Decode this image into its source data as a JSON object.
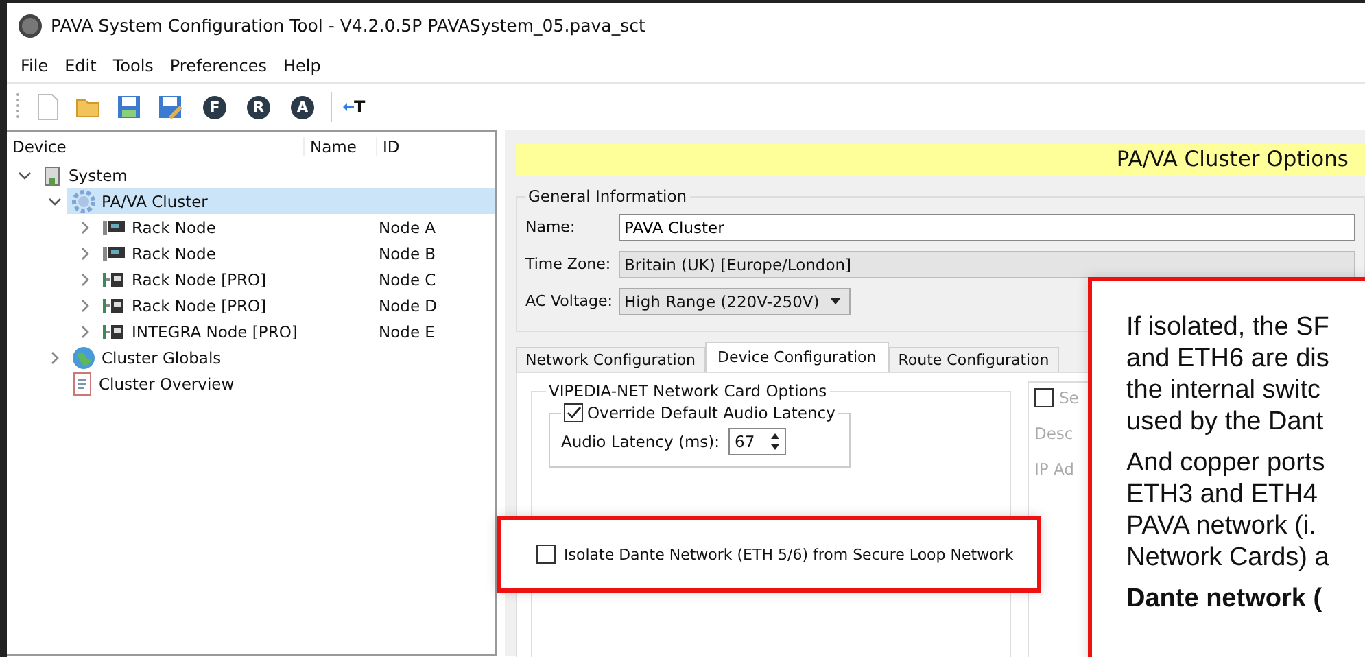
{
  "window": {
    "title": "PAVA System Configuration Tool - V4.2.0.5P PAVASystem_05.pava_sct"
  },
  "menu": [
    "File",
    "Edit",
    "Tools",
    "Preferences",
    "Help"
  ],
  "toolbar": [
    {
      "kind": "new"
    },
    {
      "kind": "open"
    },
    {
      "kind": "save"
    },
    {
      "kind": "saveas"
    },
    {
      "kind": "letter",
      "label": "F"
    },
    {
      "kind": "letter",
      "label": "R"
    },
    {
      "kind": "letter",
      "label": "A"
    },
    {
      "kind": "sep"
    },
    {
      "kind": "text",
      "label": "T"
    }
  ],
  "tree": {
    "columns": [
      "Device",
      "Name",
      "ID"
    ],
    "items": [
      {
        "label": "System",
        "kind": "building",
        "expanded": true,
        "selected": false,
        "children": [
          {
            "label": "PA/VA Cluster",
            "kind": "gear",
            "expanded": true,
            "selected": true,
            "children": [
              {
                "label": "Rack Node",
                "name": "Node A",
                "kind": "rack",
                "expanded": false,
                "selected": false
              },
              {
                "label": "Rack Node",
                "name": "Node B",
                "kind": "rack",
                "expanded": false,
                "selected": false
              },
              {
                "label": "Rack Node [PRO]",
                "name": "Node C",
                "kind": "pro",
                "expanded": false,
                "selected": false
              },
              {
                "label": "Rack Node [PRO]",
                "name": "Node D",
                "kind": "pro",
                "expanded": false,
                "selected": false
              },
              {
                "label": "INTEGRA Node [PRO]",
                "name": "Node E",
                "kind": "pro",
                "expanded": false,
                "selected": false
              }
            ]
          },
          {
            "label": "Cluster Globals",
            "kind": "globe",
            "expanded": false,
            "selected": false
          },
          {
            "label": "Cluster Overview",
            "kind": "doc",
            "selected": false
          }
        ]
      }
    ]
  },
  "panel": {
    "title": "PA/VA Cluster Options",
    "general": {
      "title": "General Information",
      "name_label": "Name:",
      "name_value": "PAVA Cluster",
      "timezone_label": "Time Zone:",
      "timezone_value": "Britain (UK) [Europe/London]",
      "voltage_label": "AC Voltage:",
      "voltage_value": "High Range (220V-250V)"
    },
    "tabs": [
      {
        "label": "Network Configuration",
        "selected": false
      },
      {
        "label": "Device Configuration",
        "selected": true
      },
      {
        "label": "Route Configuration",
        "selected": false
      }
    ],
    "card_options": {
      "title": "VIPEDIA-NET Network Card Options",
      "override_label": "Override Default Audio Latency",
      "override_checked": true,
      "latency_label": "Audio Latency (ms):",
      "latency_value": "67"
    },
    "right_group": {
      "checkbox_label": "Se",
      "checked": false,
      "desc_label": "Desc",
      "ip_label": "IP Ad"
    }
  },
  "callouts": [
    {
      "kind": "checkbox",
      "label": "Isolate Dante Network (ETH 5/6) from Secure Loop Network",
      "checked": false
    },
    {
      "kind": "note",
      "paragraphs": [
        {
          "bold": false,
          "lines": [
            "If isolated, the SF",
            "and ETH6 are dis",
            "the internal switc",
            "used by the Dant"
          ]
        },
        {
          "bold": false,
          "lines": [
            "And copper ports",
            "ETH3 and ETH4",
            "PAVA network (i.",
            "Network Cards) a"
          ]
        },
        {
          "bold": true,
          "lines": [
            "Dante network ("
          ]
        }
      ]
    }
  ]
}
